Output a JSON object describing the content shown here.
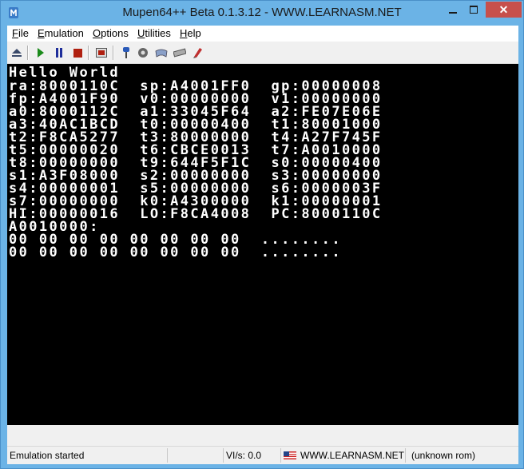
{
  "window": {
    "title": "Mupen64++ Beta 0.1.3.12 - WWW.LEARNASM.NET",
    "close_glyph": "✕"
  },
  "menu": [
    {
      "accel": "F",
      "rest": "ile"
    },
    {
      "accel": "E",
      "rest": "mulation"
    },
    {
      "accel": "O",
      "rest": "ptions"
    },
    {
      "accel": "U",
      "rest": "tilities"
    },
    {
      "accel": "H",
      "rest": "elp"
    }
  ],
  "toolbar": {
    "icons": [
      "eject-icon",
      "play-icon",
      "pause-icon",
      "stop-icon",
      "fullscreen-icon",
      "plugin-settings-icon",
      "rom-browser-icon",
      "controller-icon",
      "audio-icon",
      "rsp-icon"
    ],
    "colors": {
      "play": "#1a8a1a",
      "pause": "#1e2e9a",
      "stop": "#b02010"
    }
  },
  "screen": {
    "lines": [
      "Hello World",
      "ra:8000110C  sp:A4001FF0  gp:00000008",
      "fp:A4001F90  v0:00000000  v1:00000000",
      "a0:8000112C  a1:33045F64  a2:FE07E06E",
      "a3:40AC1BCD  t0:00000400  t1:80001000",
      "t2:F8CA5277  t3:80000000  t4:A27F745F",
      "t5:00000020  t6:CBCE0013  t7:A0010000",
      "t8:00000000  t9:644F5F1C  s0:00000400",
      "s1:A3F08000  s2:00000000  s3:00000000",
      "s4:00000001  s5:00000000  s6:0000003F",
      "s7:00000000  k0:A4300000  k1:00000001",
      "HI:00000016  LO:F8CA4008  PC:8000110C",
      "A0010000:",
      "00 00 00 00 00 00 00 00  ........",
      "00 00 00 00 00 00 00 00  ........"
    ]
  },
  "status": {
    "message": "Emulation started",
    "vi": "VI/s: 0.0",
    "site": "WWW.LEARNASM.NET",
    "rom": "(unknown rom)"
  }
}
